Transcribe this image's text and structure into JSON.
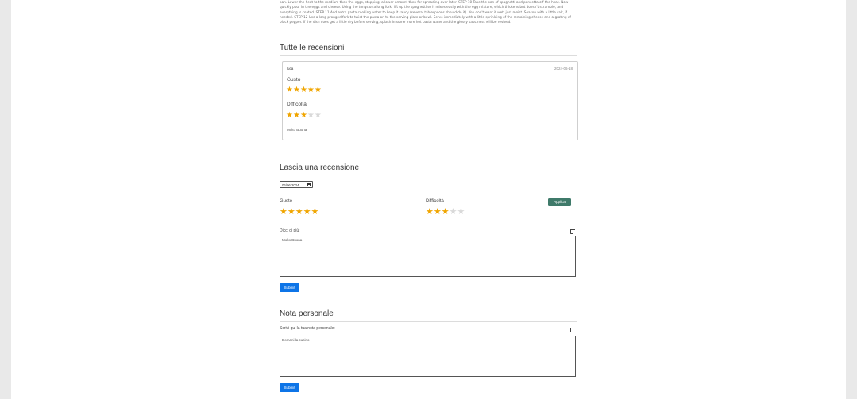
{
  "recipe_steps_text": "pan. Lower the heat to the medium then the eggs, stopping, a lower amount then for spreading over later. STEP 10 Take the pan of spaghetti and pancetta off the heat. Now quickly pour in the eggs and cheese. Using the tongs or a long fork, lift up the spaghetti so it mixes easily with the egg mixture, which thickens but doesn't scramble, and everything is coated. STEP 11 Add extra pasta cooking water to keep it saucy (several tablespoons should do it). You don't want it wet, just moist. Season with a little salt, if needed. STEP 12 Use a long-pronged fork to twist the pasta on to the serving plate or bowl. Serve immediately with a little sprinkling of the remaining cheese and a grating of black pepper. If the dish does get a little dry before serving, splash in some more hot pasta water and the glossy sauciness will be revived.",
  "reviews_section": {
    "title": "Tutte le recensioni",
    "reviews": [
      {
        "author": "luca",
        "date": "2024-06-18",
        "taste_label": "Gusto",
        "taste_rating": 5,
        "difficulty_label": "Difficoltà",
        "difficulty_rating": 3,
        "comment": "Molto Buona"
      }
    ]
  },
  "leave_review": {
    "title": "Lascia una recensione",
    "date_value": "06/06/2024",
    "taste_label": "Gusto",
    "taste_rating": 5,
    "difficulty_label": "Difficoltà",
    "difficulty_rating": 3,
    "apply_button": "Applica",
    "comment_label": "Dicci di più:",
    "comment_value": "Molto Buona",
    "submit_button": "Submit"
  },
  "personal_note": {
    "title": "Nota personale",
    "label": "Scrivi qui la tua nota personale:",
    "value": "Domani la cucino",
    "submit_button": "Submit"
  },
  "colors": {
    "star_on": "#f0a500",
    "star_off": "#d9d9d9",
    "apply_button_bg": "#3f7a6a",
    "submit_button_bg": "#0d74e7"
  },
  "max_stars": 5
}
